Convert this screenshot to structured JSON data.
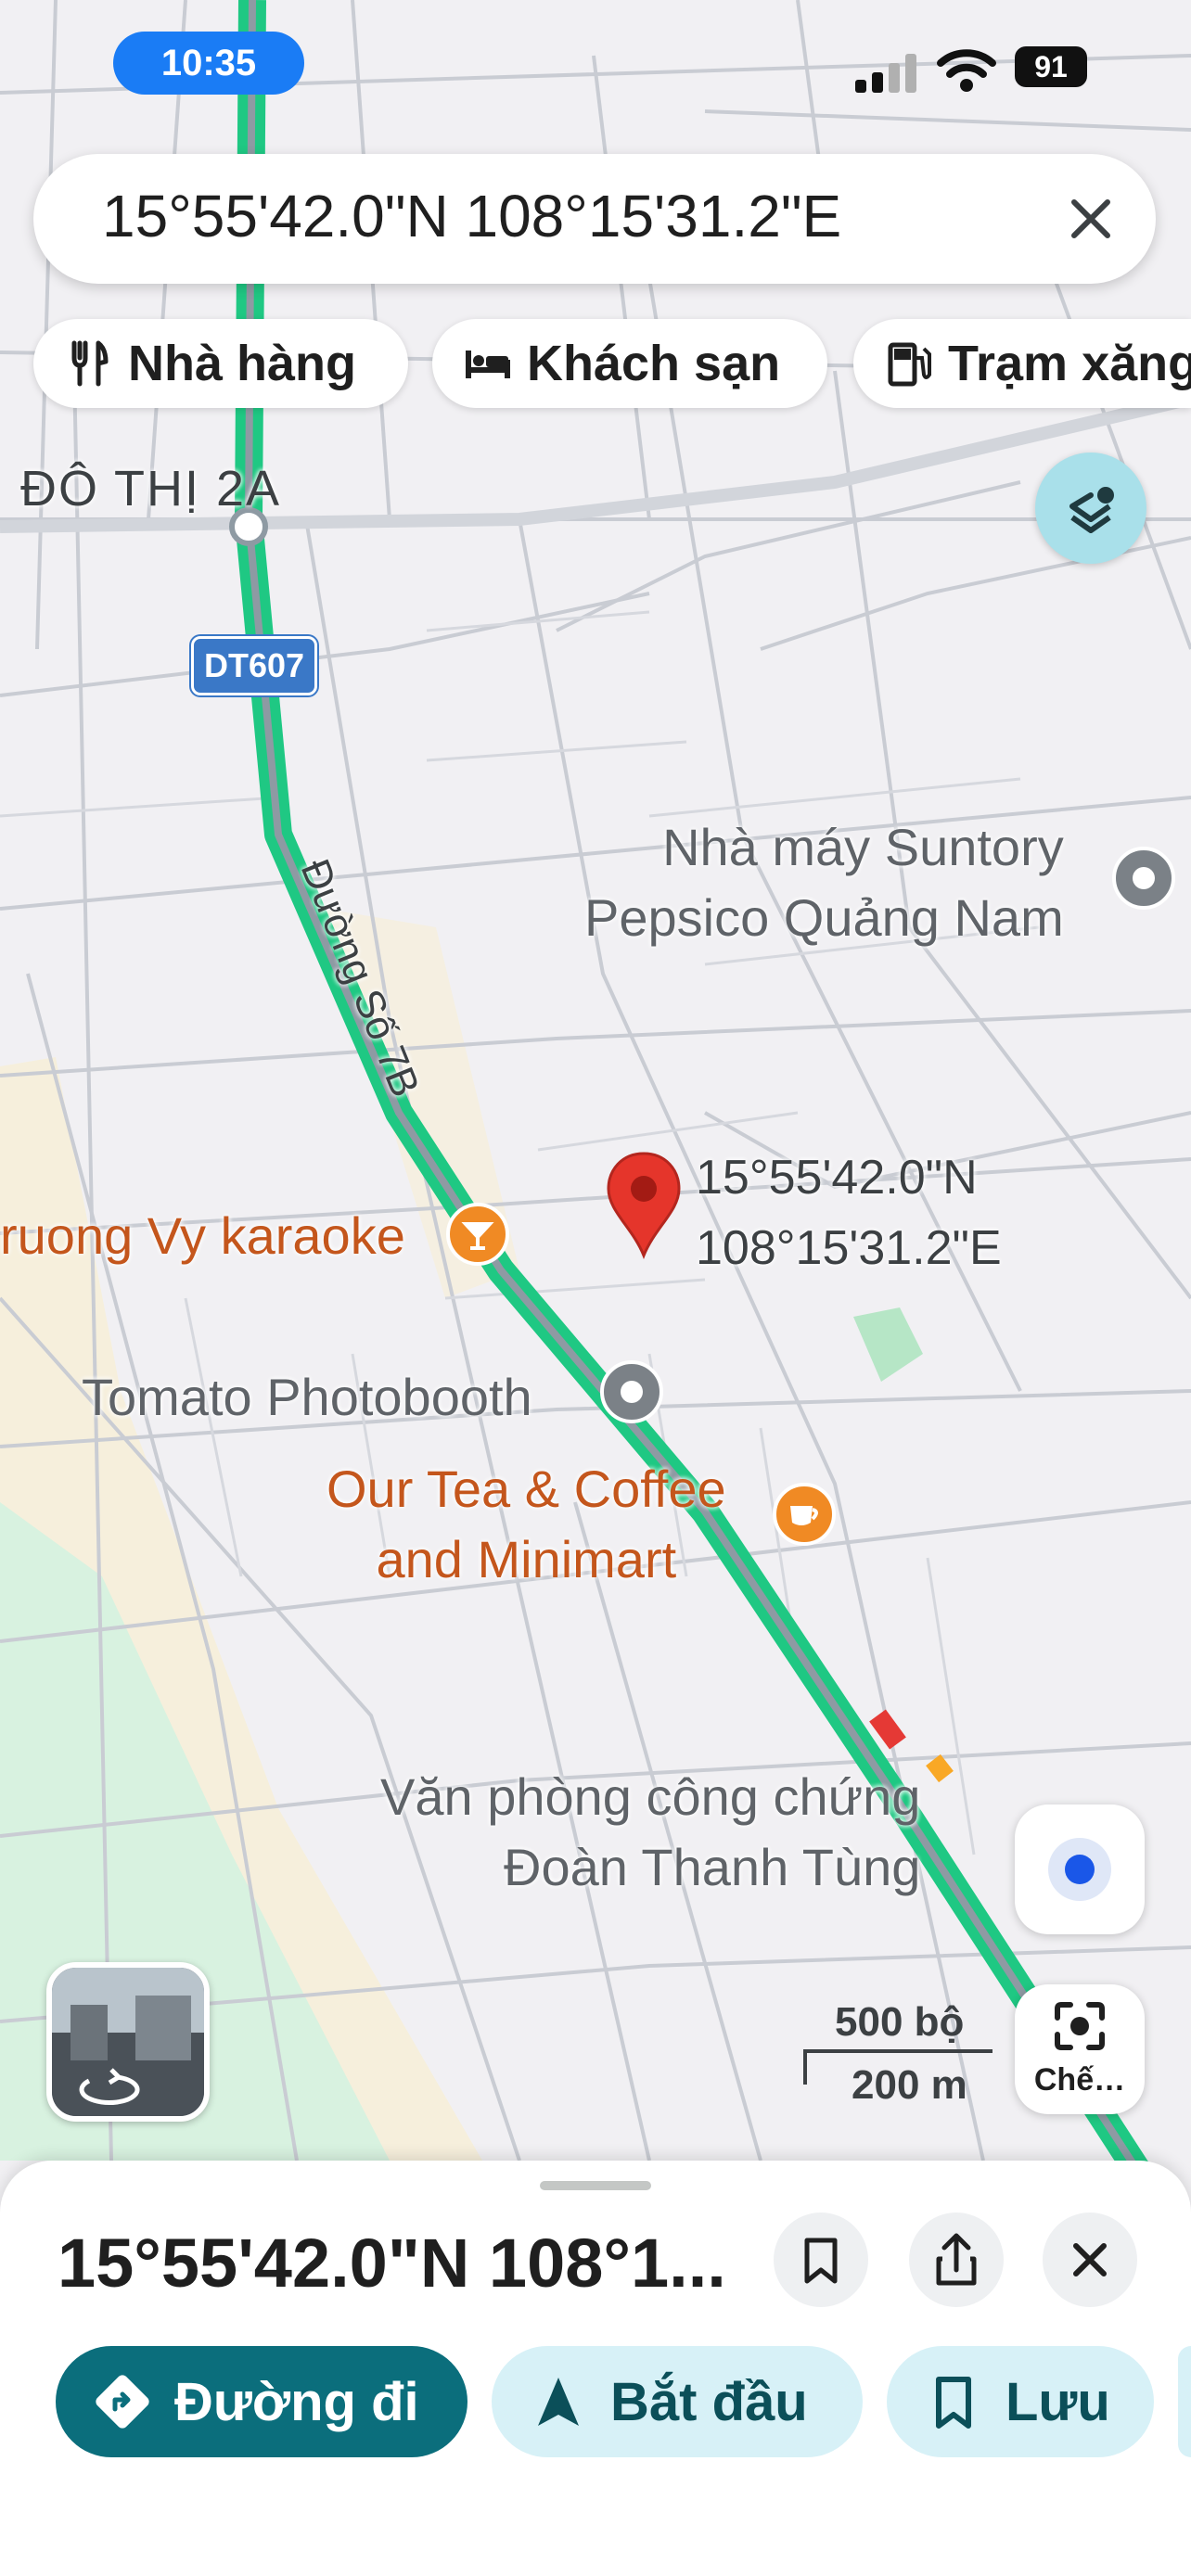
{
  "status_bar": {
    "time": "10:35",
    "battery": "91"
  },
  "search": {
    "query": "15°55'42.0\"N 108°15'31.2\"E"
  },
  "chips": [
    {
      "label": "Nhà hàng",
      "icon": "restaurant-icon"
    },
    {
      "label": "Khách sạn",
      "icon": "hotel-icon"
    },
    {
      "label": "Trạm xăng",
      "icon": "gas-station-icon"
    }
  ],
  "map": {
    "area_label": "ĐÔ THỊ 2A",
    "route_shield": "DT607",
    "street_label": "Đường Số 7B",
    "places": {
      "suntory": [
        "Nhà máy Suntory",
        "Pepsico Quảng Nam"
      ],
      "karaoke": "ruong Vy karaoke",
      "tomato": "Tomato Photobooth",
      "ourtea": [
        "Our Tea & Coffee",
        "and Minimart"
      ],
      "notary": [
        "Văn phòng công chứng",
        "Đoàn Thanh Tùng"
      ]
    },
    "pin_label": [
      "15°55'42.0\"N",
      "108°15'31.2\"E"
    ],
    "scale": {
      "imperial": "500 bộ",
      "metric": "200 m"
    },
    "camera_label": "Chế…"
  },
  "sheet": {
    "title": "15°55'42.0\"N 108°1...",
    "actions": [
      {
        "label": "Đường đi",
        "icon": "directions-icon"
      },
      {
        "label": "Bắt đầu",
        "icon": "navigation-arrow-icon"
      },
      {
        "label": "Lưu",
        "icon": "bookmark-icon"
      }
    ]
  },
  "colors": {
    "route": "#1fc883",
    "route_center": "#8e9aa3",
    "pin": "#e5352b",
    "primary_button": "#0b6e7c",
    "secondary_button": "#d7f1f7",
    "orange_poi": "#f08a24"
  }
}
